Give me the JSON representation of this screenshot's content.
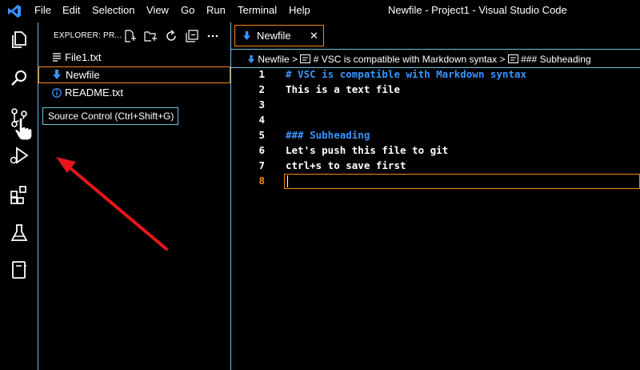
{
  "titlebar": {
    "menu": [
      "File",
      "Edit",
      "Selection",
      "View",
      "Go",
      "Run",
      "Terminal",
      "Help"
    ],
    "window_title": "Newfile - Project1 - Visual Studio Code"
  },
  "activitybar": {
    "icons": [
      "explorer-icon",
      "search-icon",
      "source-control-icon",
      "run-debug-icon",
      "extensions-icon",
      "testing-icon",
      "notebook-icon"
    ]
  },
  "tooltip": {
    "text": "Source Control (Ctrl+Shift+G)"
  },
  "sidebar": {
    "title": "EXPLORER: PR...",
    "files": [
      {
        "name": "File1.txt",
        "icon": "text-file-icon"
      },
      {
        "name": "Newfile",
        "icon": "markdown-down-arrow-icon"
      },
      {
        "name": "README.txt",
        "icon": "info-icon"
      }
    ]
  },
  "editor": {
    "tab": {
      "label": "Newfile",
      "close": "✕"
    },
    "breadcrumb": {
      "file": "Newfile",
      "sep": ">",
      "item1": "# VSC is compatible with Markdown syntax",
      "item2": "### Subheading"
    },
    "lines": [
      {
        "num": "1",
        "text": "# VSC is compatible with Markdown syntax",
        "heading": true
      },
      {
        "num": "2",
        "text": "This is a text file"
      },
      {
        "num": "3",
        "text": ""
      },
      {
        "num": "4",
        "text": ""
      },
      {
        "num": "5",
        "text": "### Subheading",
        "heading": true
      },
      {
        "num": "6",
        "text": "Let's push this file to git"
      },
      {
        "num": "7",
        "text": "ctrl+s to save first"
      },
      {
        "num": "8",
        "text": ""
      }
    ]
  },
  "colors": {
    "accent": "#6fc3df",
    "focus": "#f38518",
    "heading": "#3794ff",
    "arrow": "#e8151b"
  }
}
